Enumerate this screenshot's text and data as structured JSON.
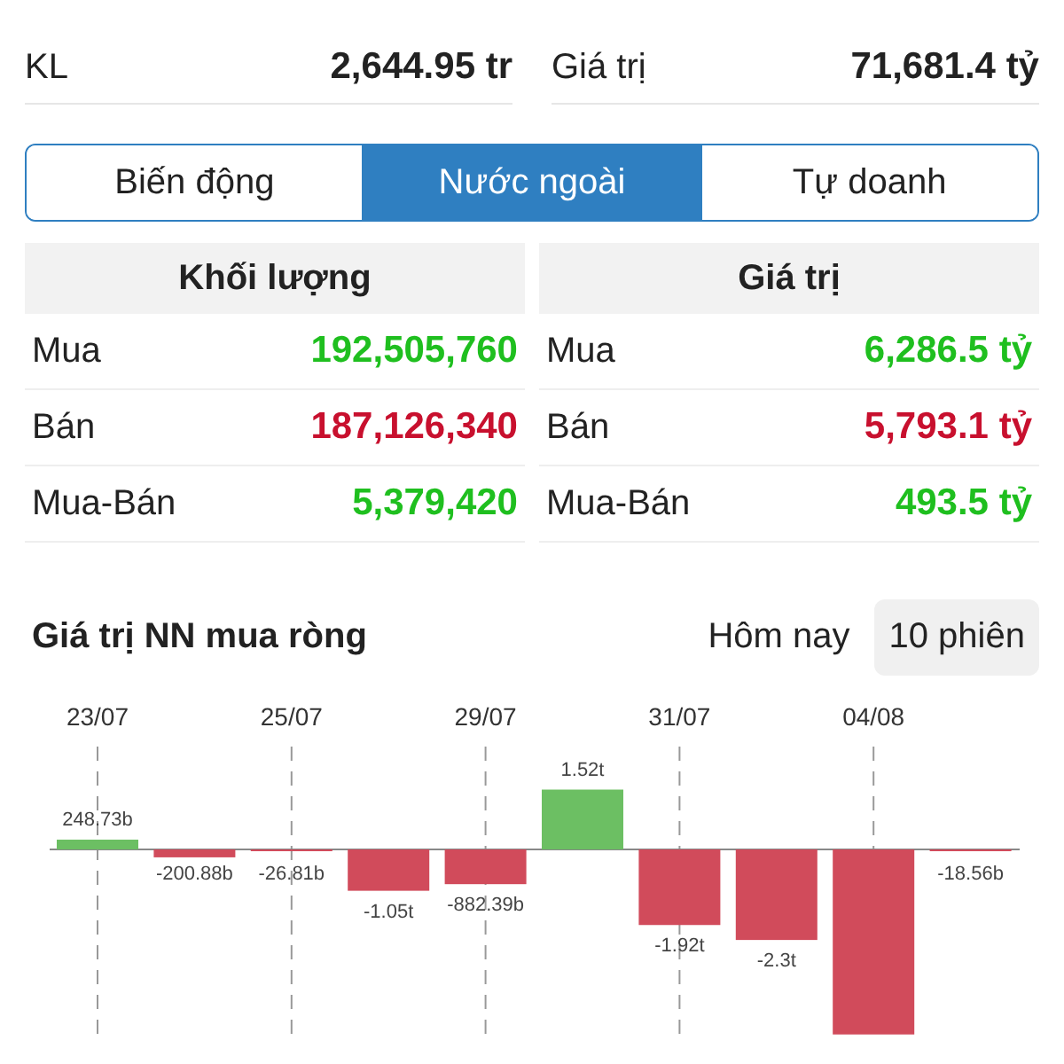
{
  "summary": [
    {
      "label": "KL",
      "value": "2,644.95 tr"
    },
    {
      "label": "Giá trị",
      "value": "71,681.4 tỷ"
    }
  ],
  "tabs": [
    {
      "label": "Biến động",
      "selected": false
    },
    {
      "label": "Nước ngoài",
      "selected": true
    },
    {
      "label": "Tự doanh",
      "selected": false
    }
  ],
  "foreign": {
    "columns": [
      {
        "title": "Khối lượng",
        "rows": [
          {
            "label": "Mua",
            "value": "192,505,760",
            "color": "#1fbf1f"
          },
          {
            "label": "Bán",
            "value": "187,126,340",
            "color": "#c8102e"
          },
          {
            "label": "Mua-Bán",
            "value": "5,379,420",
            "color": "#1fbf1f"
          }
        ]
      },
      {
        "title": "Giá trị",
        "rows": [
          {
            "label": "Mua",
            "value": "6,286.5 tỷ",
            "color": "#1fbf1f"
          },
          {
            "label": "Bán",
            "value": "5,793.1 tỷ",
            "color": "#c8102e"
          },
          {
            "label": "Mua-Bán",
            "value": "493.5 tỷ",
            "color": "#1fbf1f"
          }
        ]
      }
    ]
  },
  "net_chart": {
    "title": "Giá trị NN mua ròng",
    "periods": [
      {
        "label": "Hôm nay",
        "selected": false
      },
      {
        "label": "10 phiên",
        "selected": true
      }
    ],
    "chart_data": {
      "type": "bar",
      "grid": true,
      "categories": [
        "23/07",
        null,
        "25/07",
        null,
        "29/07",
        null,
        "31/07",
        null,
        "04/08",
        null
      ],
      "values": [
        248730000000,
        -200880000000,
        -26810000000,
        -1050000000000,
        -882390000000,
        1520000000000,
        -1920000000000,
        -2300000000000,
        -4700000000000,
        -18560000000
      ],
      "value_labels": [
        "248.73b",
        "-200.88b",
        "-26.81b",
        "-1.05t",
        "-882.39b",
        "1.52t",
        "-1.92t",
        "-2.3t",
        null,
        "-18.56b"
      ]
    }
  }
}
